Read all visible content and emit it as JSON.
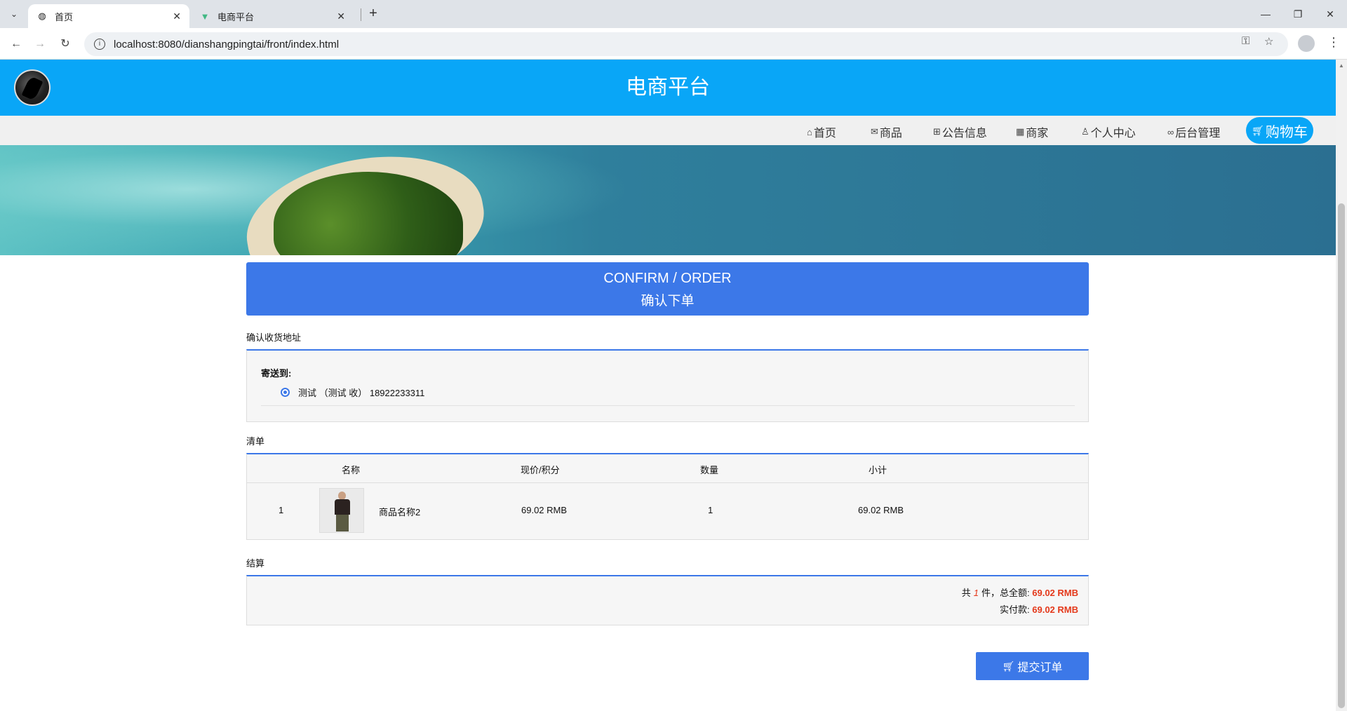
{
  "browser": {
    "tabs": [
      {
        "title": "首页",
        "favicon": "globe-icon"
      },
      {
        "title": "电商平台",
        "favicon": "vue-icon"
      }
    ],
    "url": "localhost:8080/dianshangpingtai/front/index.html"
  },
  "header": {
    "site_title": "电商平台"
  },
  "nav": {
    "items": [
      {
        "label": "首页",
        "icon": "home-icon"
      },
      {
        "label": "商品",
        "icon": "mail-icon"
      },
      {
        "label": "公告信息",
        "icon": "gift-icon"
      },
      {
        "label": "商家",
        "icon": "calendar-icon"
      },
      {
        "label": "个人中心",
        "icon": "user-icon"
      },
      {
        "label": "后台管理",
        "icon": "link-icon"
      }
    ],
    "cart_label": "购物车"
  },
  "confirm": {
    "title_en": "CONFIRM / ORDER",
    "title_zh": "确认下单"
  },
  "address": {
    "section_label": "确认收货地址",
    "send_to_label": "寄送到:",
    "selected": "测试 （测试 收） 18922233311"
  },
  "order_list": {
    "section_label": "清单",
    "columns": [
      "名称",
      "现价/积分",
      "数量",
      "小计"
    ],
    "rows": [
      {
        "index": "1",
        "name": "商品名称2",
        "price": "69.02 RMB",
        "quantity": "1",
        "subtotal": "69.02 RMB"
      }
    ]
  },
  "settlement": {
    "section_label": "结算",
    "count_prefix": "共",
    "count": "1",
    "count_suffix": "件，总全额:",
    "total": "69.02 RMB",
    "paid_label": "实付款:",
    "paid": "69.02 RMB"
  },
  "submit_label": "提交订单",
  "colors": {
    "header_bg": "#09a6f7",
    "primary": "#3c78e8",
    "price_red": "#e4391b"
  }
}
